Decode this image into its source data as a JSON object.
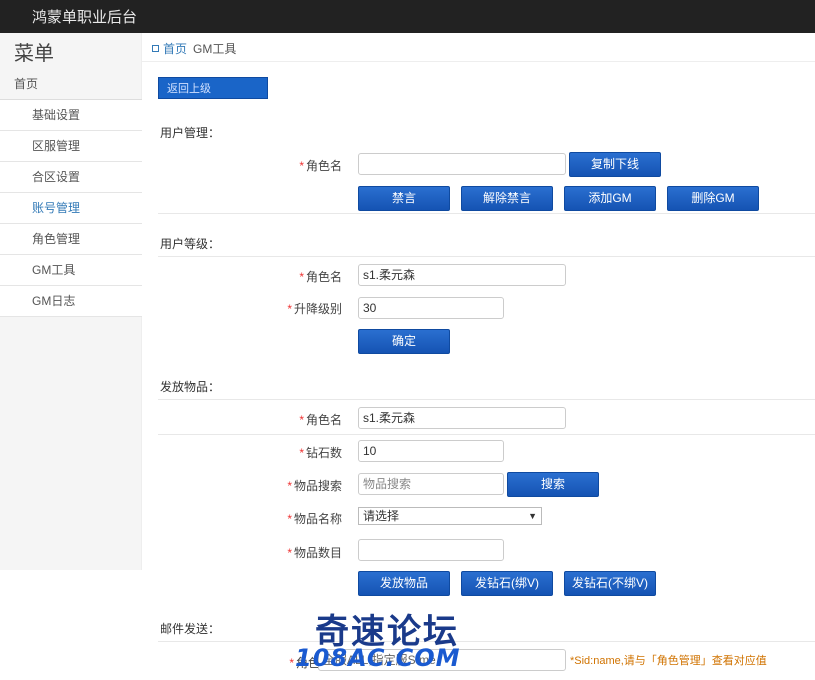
{
  "app": {
    "title": "鸿蒙单职业后台"
  },
  "sidebar": {
    "menu_title": "菜单",
    "items": [
      {
        "label": "首页"
      },
      {
        "label": "基础设置"
      },
      {
        "label": "区服管理"
      },
      {
        "label": "合区设置"
      },
      {
        "label": "账号管理"
      },
      {
        "label": "角色管理"
      },
      {
        "label": "GM工具"
      },
      {
        "label": "GM日志"
      }
    ]
  },
  "breadcrumb": {
    "home": "首页",
    "current": "GM工具"
  },
  "top_button": "返回上级",
  "user_mgmt": {
    "title": "用户管理：",
    "role_label": "角色名",
    "role_value": "",
    "copy_button": "复制下线",
    "buttons": [
      "禁言",
      "解除禁言",
      "添加GM",
      "删除GM"
    ]
  },
  "user_level": {
    "title": "用户等级：",
    "role_label": "角色名",
    "role_value": "s1.柔元森",
    "level_label": "升降级别",
    "level_value": "30",
    "confirm_button": "确定"
  },
  "send_items": {
    "title": "发放物品：",
    "role_label": "角色名",
    "role_value": "s1.柔元森",
    "diamond_label": "钻石数",
    "diamond_value": "10",
    "search_label": "物品搜索",
    "search_placeholder": "物品搜索",
    "search_button": "搜索",
    "name_label": "物品名称",
    "name_selected": "请选择",
    "count_label": "物品数目",
    "count_value": "",
    "buttons": [
      "发放物品",
      "发钻石(绑V)",
      "发钻石(不绑V)"
    ]
  },
  "mail": {
    "title": "邮件发送：",
    "role_label": "角色",
    "role_value": "全服ALL,指定服S",
    "role_value_tail": "me",
    "hint": "*Sid:name,请与「角色管理」查看对应值"
  },
  "watermark": {
    "cn": "奇速论坛",
    "en": "108AC.COM"
  },
  "colors": {
    "topbar": "#222222",
    "primary": "#1a5fc4",
    "required": "#ee3333",
    "hint": "#d07300"
  }
}
